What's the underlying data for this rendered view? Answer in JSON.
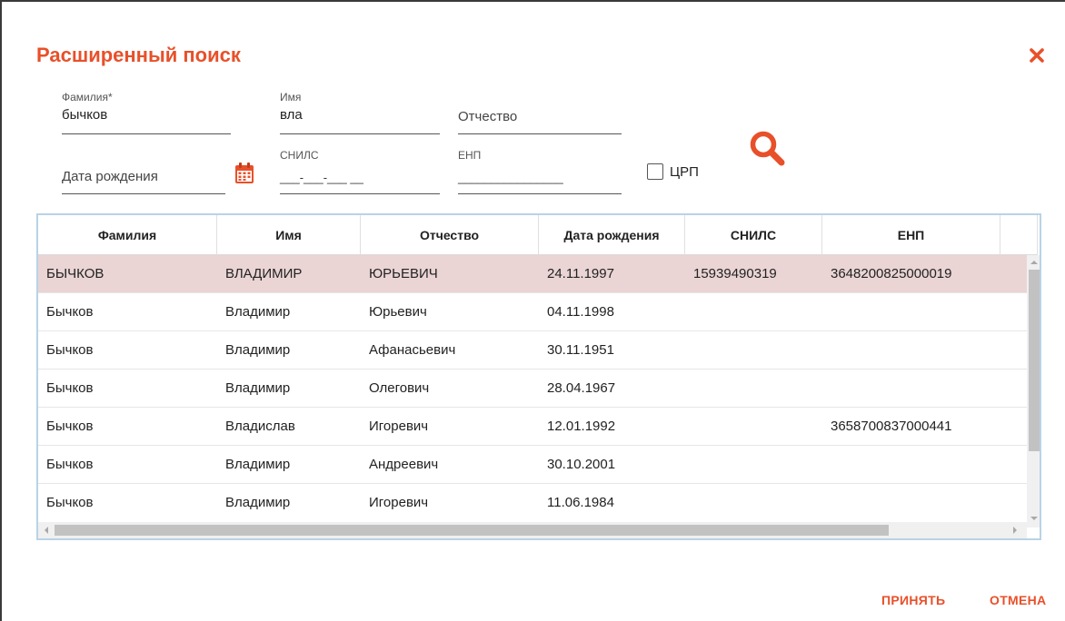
{
  "dialog": {
    "title": "Расширенный поиск"
  },
  "fields": {
    "surname": {
      "label": "Фамилия*",
      "value": "бычков"
    },
    "name": {
      "label": "Имя",
      "value": "вла"
    },
    "patronymic": {
      "placeholder": "Отчество"
    },
    "birthdate": {
      "placeholder": "Дата рождения"
    },
    "snils": {
      "label": "СНИЛС",
      "mask": "___-___-___ __"
    },
    "enp": {
      "label": "ЕНП",
      "mask": "________________"
    }
  },
  "crp": {
    "label": "ЦРП",
    "checked": false
  },
  "table": {
    "columns": [
      "Фамилия",
      "Имя",
      "Отчество",
      "Дата рождения",
      "СНИЛС",
      "ЕНП"
    ],
    "rows": [
      [
        "БЫЧКОВ",
        "ВЛАДИМИР",
        "ЮРЬЕВИЧ",
        "24.11.1997",
        "15939490319",
        "3648200825000019"
      ],
      [
        "Бычков",
        "Владимир",
        "Юрьевич",
        "04.11.1998",
        "",
        ""
      ],
      [
        "Бычков",
        "Владимир",
        "Афанасьевич",
        "30.11.1951",
        "",
        ""
      ],
      [
        "Бычков",
        "Владимир",
        "Олегович",
        "28.04.1967",
        "",
        ""
      ],
      [
        "Бычков",
        "Владислав",
        "Игоревич",
        "12.01.1992",
        "",
        "3658700837000441"
      ],
      [
        "Бычков",
        "Владимир",
        "Андреевич",
        "30.10.2001",
        "",
        ""
      ],
      [
        "Бычков",
        "Владимир",
        "Игоревич",
        "11.06.1984",
        "",
        ""
      ]
    ],
    "selected_row": 0
  },
  "footer": {
    "accept": "ПРИНЯТЬ",
    "cancel": "ОТМЕНА"
  },
  "colors": {
    "accent": "#e8502a",
    "selected_row": "#ead4d4",
    "grid_border": "#b9d3e6"
  },
  "icons": {
    "close": "close-icon",
    "calendar": "calendar-icon",
    "search": "search-icon"
  }
}
